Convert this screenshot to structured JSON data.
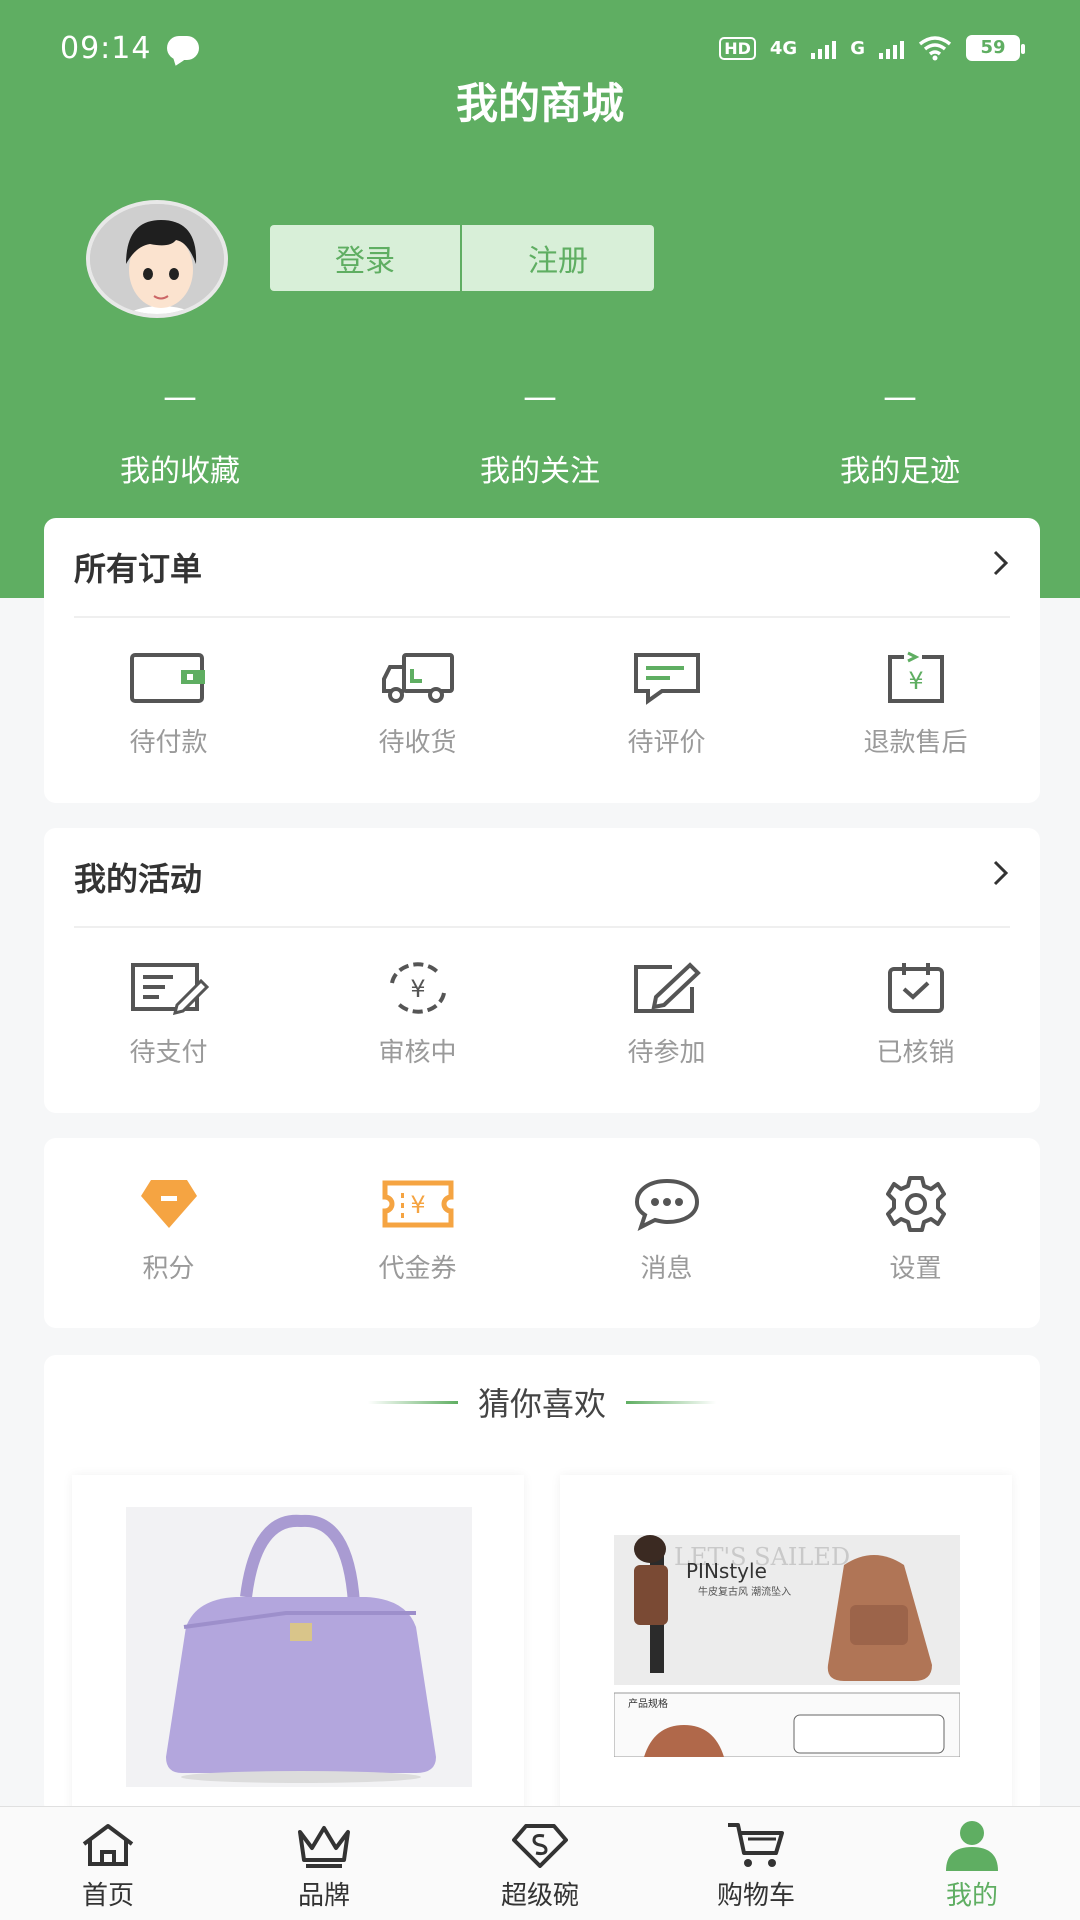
{
  "status_bar": {
    "time": "09:14",
    "net_hd": "HD",
    "net_4g": "4G",
    "net_g": "G",
    "battery": "59"
  },
  "header": {
    "title": "我的商城",
    "login_label": "登录",
    "register_label": "注册"
  },
  "stats": [
    {
      "value": "—",
      "label": "我的收藏"
    },
    {
      "value": "—",
      "label": "我的关注"
    },
    {
      "value": "—",
      "label": "我的足迹"
    }
  ],
  "orders": {
    "title": "所有订单",
    "items": [
      {
        "label": "待付款",
        "icon": "wallet-icon"
      },
      {
        "label": "待收货",
        "icon": "truck-icon"
      },
      {
        "label": "待评价",
        "icon": "comment-icon"
      },
      {
        "label": "退款售后",
        "icon": "refund-icon"
      }
    ]
  },
  "activities": {
    "title": "我的活动",
    "items": [
      {
        "label": "待支付",
        "icon": "edit-list-icon"
      },
      {
        "label": "审核中",
        "icon": "yen-cycle-icon"
      },
      {
        "label": "待参加",
        "icon": "pencil-square-icon"
      },
      {
        "label": "已核销",
        "icon": "calendar-check-icon"
      }
    ]
  },
  "tools": {
    "items": [
      {
        "label": "积分",
        "icon": "points-gem-icon"
      },
      {
        "label": "代金券",
        "icon": "coupon-icon"
      },
      {
        "label": "消息",
        "icon": "message-icon"
      },
      {
        "label": "设置",
        "icon": "settings-gear-icon"
      }
    ]
  },
  "recommend": {
    "title": "猜你喜欢",
    "products": [
      {
        "image": "purple-handbag-photo"
      },
      {
        "image": "brown-backpack-ad",
        "ad_text": "PINstyle",
        "ad_sub": "牛皮复古风  潮流坠入",
        "ad_banner": "LET'S SAILED",
        "spec_label": "产品规格"
      }
    ]
  },
  "tabbar": {
    "items": [
      {
        "label": "首页",
        "icon": "home-icon"
      },
      {
        "label": "品牌",
        "icon": "crown-icon"
      },
      {
        "label": "超级碗",
        "icon": "super-bowl-icon"
      },
      {
        "label": "购物车",
        "icon": "cart-icon"
      },
      {
        "label": "我的",
        "icon": "user-icon"
      }
    ]
  },
  "colors": {
    "primary": "#5fae62",
    "accent_orange": "#f5a442"
  }
}
